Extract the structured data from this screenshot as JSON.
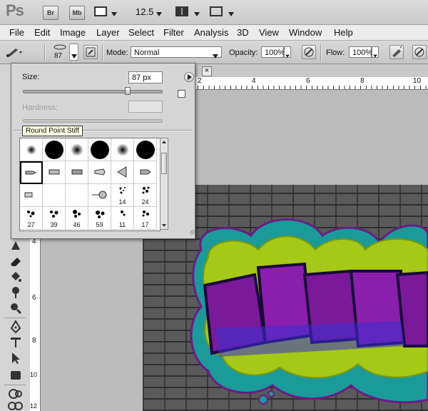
{
  "app": {
    "logo": "Ps",
    "bridge_label": "Br",
    "minibridge_label": "Mb",
    "zoom": "12.5"
  },
  "menu": [
    "File",
    "Edit",
    "Image",
    "Layer",
    "Select",
    "Filter",
    "Analysis",
    "3D",
    "View",
    "Window",
    "Help"
  ],
  "options": {
    "brush_size_value": "87",
    "mode_label": "Mode:",
    "mode_value": "Normal",
    "opacity_label": "Opacity:",
    "opacity_value": "100%",
    "flow_label": "Flow:",
    "flow_value": "100%"
  },
  "brush_picker": {
    "size_label": "Size:",
    "size_value": "87 px",
    "size_slider_fraction": 0.75,
    "hardness_label": "Hardness:",
    "hardness_value": "",
    "tooltip": "Round Point Stiff",
    "row3_numbers": [
      "14",
      "24"
    ],
    "row4_numbers": [
      "27",
      "39",
      "46",
      "59",
      "11",
      "17"
    ]
  },
  "document": {
    "close_label": "×",
    "ruler_top": [
      "2",
      "4",
      "6",
      "8",
      "10"
    ],
    "ruler_left": [
      "4",
      "6",
      "8",
      "10",
      "12"
    ]
  },
  "colors": {
    "accent_purple": "#7a1a9a",
    "accent_lime": "#a6c816",
    "accent_teal": "#1b9a9a"
  }
}
